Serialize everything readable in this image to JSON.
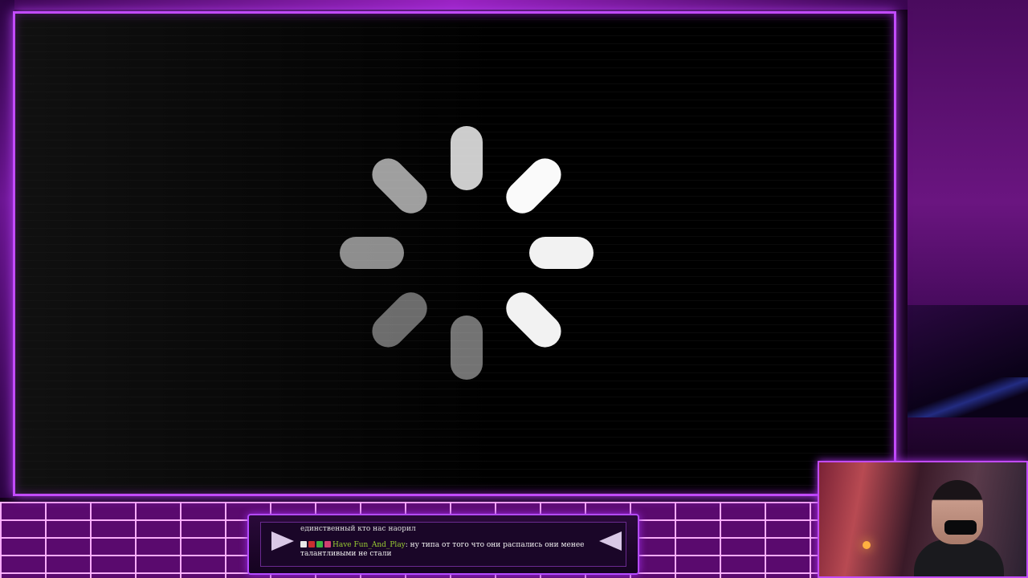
{
  "stream": {
    "state": "loading"
  },
  "chat": {
    "previous_message": "единственный кто нас наорил",
    "message": {
      "username": "Have Fun_And_Play",
      "separator": ":",
      "text_line1": " ну типа от того что они распались они менее",
      "text_line2": "талантливыми не стали"
    }
  },
  "colors": {
    "neon_border": "#c24bff",
    "grid_floor": "#5a0a6e",
    "username": "#9acd32",
    "spinner_bar": "#ffffff"
  }
}
